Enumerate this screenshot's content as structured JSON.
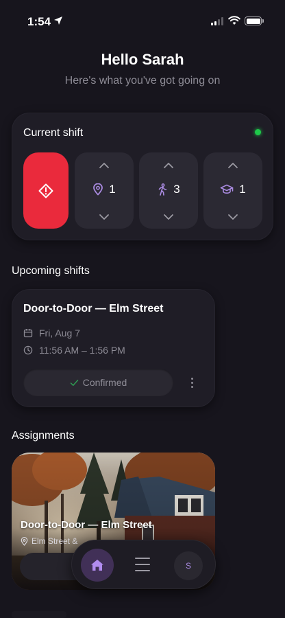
{
  "status_bar": {
    "time": "1:54"
  },
  "header": {
    "greeting": "Hello Sarah",
    "subtitle": "Here's what you've got going on"
  },
  "current_shift": {
    "title": "Current shift",
    "status_color": "#1ec94a",
    "alert_color": "#ea2a3c",
    "counters": [
      {
        "icon": "map-pin-icon",
        "count": "1"
      },
      {
        "icon": "walking-person-icon",
        "count": "3"
      },
      {
        "icon": "graduation-cap-icon",
        "count": "1"
      }
    ]
  },
  "upcoming": {
    "section_title": "Upcoming shifts",
    "card": {
      "title": "Door-to-Door — Elm Street",
      "date": "Fri, Aug 7",
      "time": "11:56 AM – 1:56 PM",
      "status": "Confirmed"
    }
  },
  "assignments": {
    "section_title": "Assignments",
    "card": {
      "title": "Door-to-Door — Elm Street",
      "location": "Elm Street &"
    }
  },
  "nav": {
    "avatar_initial": "S",
    "accent": "#a98ae0"
  }
}
